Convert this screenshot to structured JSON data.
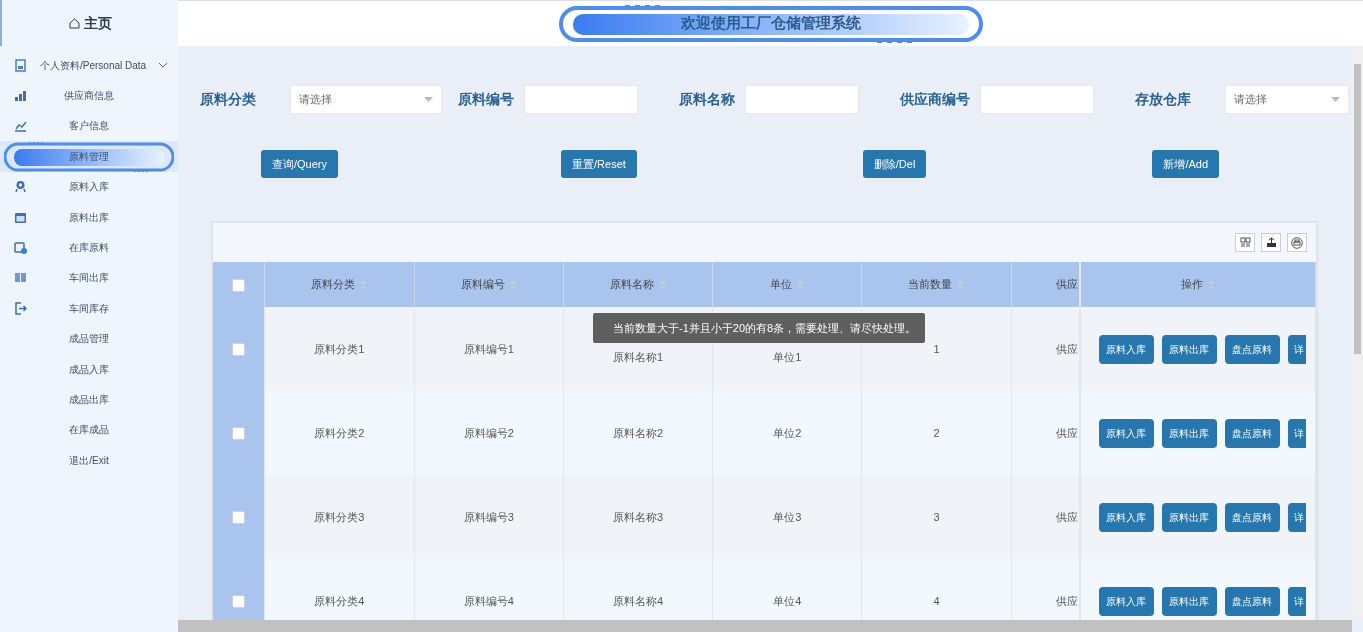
{
  "sidebar": {
    "home": "主页",
    "items": [
      {
        "label": "个人资料/Personal Data",
        "kind": "group",
        "expanded": false,
        "selected": false
      },
      {
        "label": "供应商信息",
        "kind": "link",
        "selected": false
      },
      {
        "label": "客户信息",
        "kind": "link",
        "selected": false
      },
      {
        "label": "原料管理",
        "kind": "link",
        "selected": true
      },
      {
        "label": "原料入库",
        "kind": "link",
        "selected": false
      },
      {
        "label": "原料出库",
        "kind": "link",
        "selected": false
      },
      {
        "label": "在库原料",
        "kind": "link",
        "selected": false
      },
      {
        "label": "车间出库",
        "kind": "link",
        "selected": false
      },
      {
        "label": "车间库存",
        "kind": "link",
        "selected": false
      },
      {
        "label": "成品管理",
        "kind": "link",
        "selected": false
      },
      {
        "label": "成品入库",
        "kind": "link",
        "selected": false
      },
      {
        "label": "成品出库",
        "kind": "link",
        "selected": false
      },
      {
        "label": "在库成品",
        "kind": "link",
        "selected": false
      },
      {
        "label": "退出/Exit",
        "kind": "link",
        "selected": false
      }
    ]
  },
  "header": {
    "title": "欢迎使用工厂仓储管理系统"
  },
  "filters": [
    {
      "label": "原料分类",
      "kind": "select",
      "placeholder": "请选择"
    },
    {
      "label": "原料编号",
      "kind": "text"
    },
    {
      "label": "原料名称",
      "kind": "text"
    },
    {
      "label": "供应商编号",
      "kind": "text"
    },
    {
      "label": "存放仓库",
      "kind": "select",
      "placeholder": "请选择"
    }
  ],
  "actions": [
    "查询/Query",
    "重置/Reset",
    "删除/Del",
    "新增/Add"
  ],
  "table": {
    "all_checked": false,
    "columns": [
      "原料分类",
      "原料编号",
      "原料名称",
      "单位",
      "当前数量",
      "供应"
    ],
    "ops_column": "操作",
    "rows": [
      {
        "checked": false,
        "cells": [
          "原料分类1",
          "原料编号1",
          "原料名称1",
          "单位1",
          "1",
          "供应"
        ],
        "buttons": [
          "原料入库",
          "原料出库",
          "盘点原料",
          "详"
        ]
      },
      {
        "checked": false,
        "cells": [
          "原料分类2",
          "原料编号2",
          "原料名称2",
          "单位2",
          "2",
          "供应"
        ],
        "buttons": [
          "原料入库",
          "原料出库",
          "盘点原料",
          "详"
        ]
      },
      {
        "checked": false,
        "cells": [
          "原料分类3",
          "原料编号3",
          "原料名称3",
          "单位3",
          "3",
          "供应"
        ],
        "buttons": [
          "原料入库",
          "原料出库",
          "盘点原料",
          "详"
        ]
      },
      {
        "checked": false,
        "cells": [
          "原料分类4",
          "原料编号4",
          "原料名称4",
          "单位4",
          "4",
          "供应"
        ],
        "buttons": [
          "原料入库",
          "原料出库",
          "盘点原料",
          "详"
        ]
      }
    ]
  },
  "tooltip": "当前数量大于-1并且小于20的有8条，需要处理、请尽快处理。"
}
